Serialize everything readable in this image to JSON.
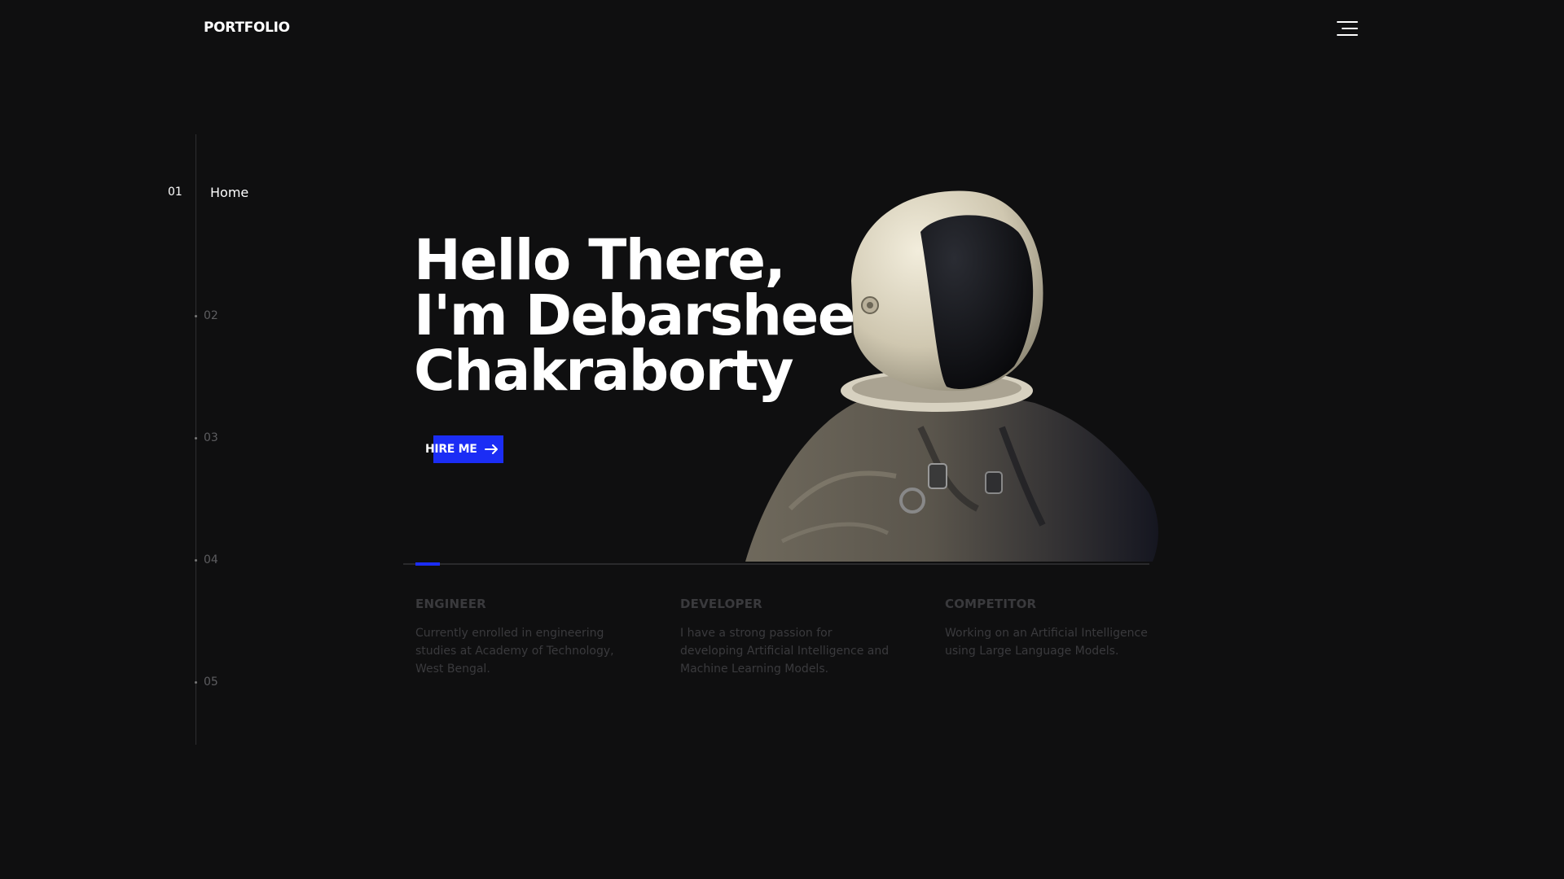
{
  "header": {
    "logo": "PORTFOLIO",
    "menu_icon": "hamburger-menu-icon"
  },
  "sidenav": {
    "items": [
      {
        "number": "01",
        "label": "Home",
        "active": true
      },
      {
        "number": "02",
        "label": "",
        "active": false
      },
      {
        "number": "03",
        "label": "",
        "active": false
      },
      {
        "number": "04",
        "label": "",
        "active": false
      },
      {
        "number": "05",
        "label": "",
        "active": false
      }
    ]
  },
  "hero": {
    "line1": "Hello There,",
    "line2": "I'm Debarshee",
    "line3": "Chakraborty",
    "cta_label": "HIRE ME",
    "cta_icon": "arrow-right-icon",
    "image": "astronaut-illustration"
  },
  "slider": {
    "current": 1,
    "total": 3
  },
  "features": [
    {
      "title": "ENGINEER",
      "text": "Currently enrolled in engineering studies at Academy of Technology, West Bengal."
    },
    {
      "title": "DEVELOPER",
      "text": "I have a strong passion for developing Artificial Intelligence and Machine Learning Models."
    },
    {
      "title": "COMPETITOR",
      "text": "Working on an Artificial Intelligence using Large Language Models."
    }
  ],
  "colors": {
    "background": "#0f0f10",
    "accent": "#1b2df5",
    "text": "#ffffff",
    "muted": "#3a3a3d"
  }
}
